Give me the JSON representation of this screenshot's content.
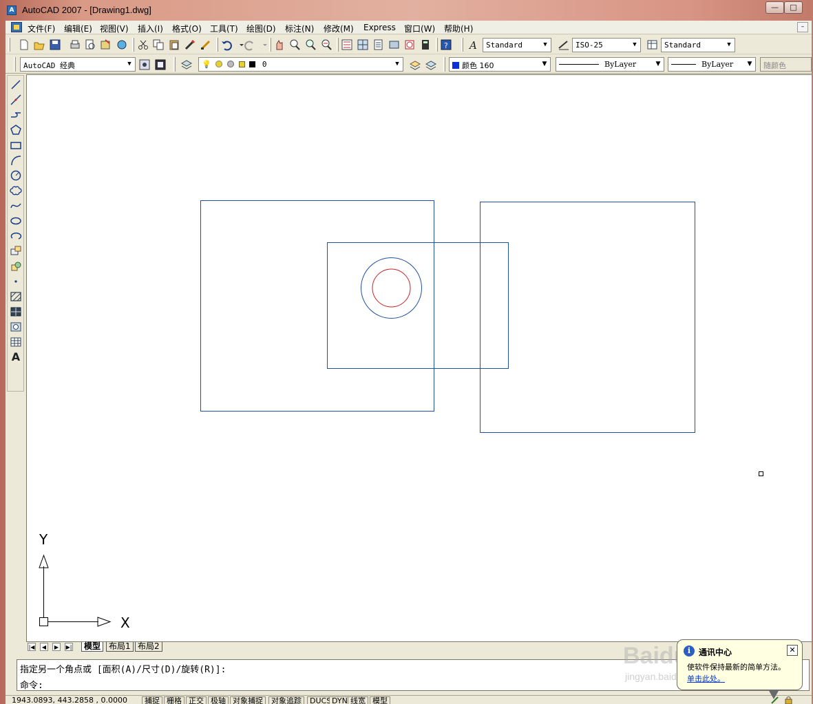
{
  "window": {
    "title": "AutoCAD 2007 - [Drawing1.dwg]",
    "min_label": "—",
    "max_label": "□"
  },
  "menubar": {
    "items": [
      "文件(F)",
      "编辑(E)",
      "视图(V)",
      "插入(I)",
      "格式(O)",
      "工具(T)",
      "绘图(D)",
      "标注(N)",
      "修改(M)",
      "Express",
      "窗口(W)",
      "帮助(H)"
    ]
  },
  "styles_toolbar": {
    "text_style": "Standard",
    "dim_style": "ISO-25",
    "table_style": "Standard"
  },
  "properties_toolbar": {
    "workspace": "AutoCAD 经典",
    "layer": "0",
    "color": "颜色 160",
    "linetype": "ByLayer",
    "lineweight": "ByLayer",
    "plot_style": "随颜色"
  },
  "draw_toolbar": {
    "tools": [
      "line-icon",
      "construction-line-icon",
      "polyline-icon",
      "polygon-icon",
      "rectangle-icon",
      "arc-icon",
      "circle-icon",
      "revision-cloud-icon",
      "spline-icon",
      "ellipse-icon",
      "ellipse-arc-icon",
      "insert-block-icon",
      "make-block-icon",
      "point-icon",
      "hatch-icon",
      "gradient-icon",
      "region-icon",
      "table-icon",
      "multiline-text-icon"
    ]
  },
  "drawing": {
    "line_color": "#1f4fa0",
    "inner_circle_color": "#cc2020",
    "ucs_y": "Y",
    "ucs_x": "X"
  },
  "layout_tabs": [
    "模型",
    "布局1",
    "布局2"
  ],
  "command": {
    "history_line": "指定另一个角点或 [面积(A)/尺寸(D)/旋转(R)]:",
    "prompt": "命令:"
  },
  "status": {
    "coords": "1943.0893, 443.2858 , 0.0000",
    "toggles": [
      "捕捉",
      "栅格",
      "正交",
      "极轴",
      "对象捕捉",
      "对象追踪",
      "DUCS",
      "DYN",
      "线宽",
      "模型"
    ]
  },
  "balloon": {
    "title": "通讯中心",
    "message": "使软件保持最新的简单方法。",
    "link": "单击此处。",
    "close": "✕"
  },
  "watermark": {
    "brand": "Baidu经验",
    "url": "jingyan.baidu.com"
  }
}
